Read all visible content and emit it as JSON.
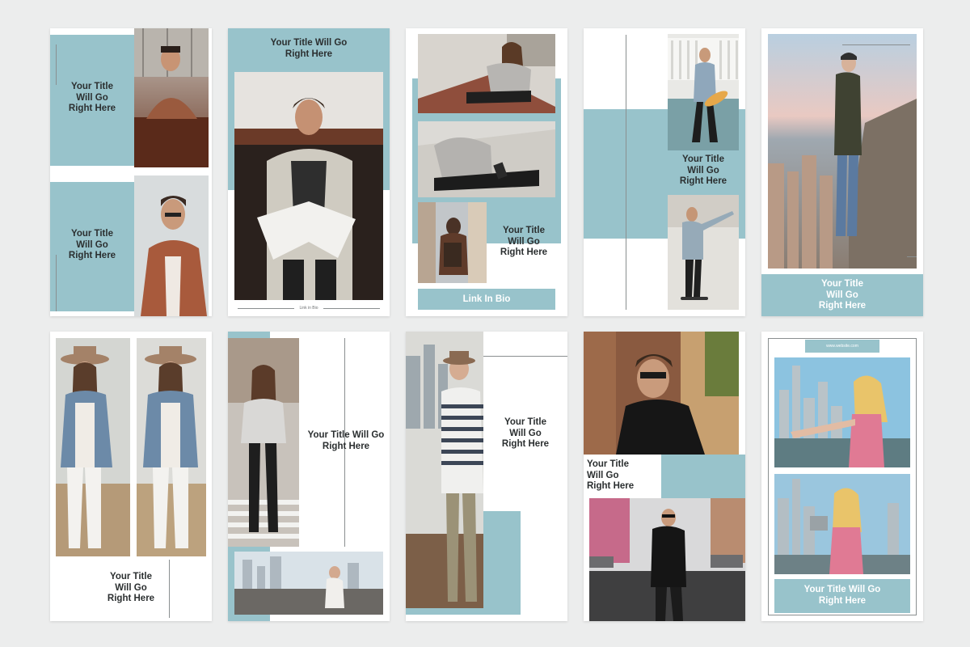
{
  "colors": {
    "accent": "#98c3cb",
    "background": "#eceded",
    "card": "#ffffff",
    "title_dark": "#2b2f30",
    "title_light": "#ffffff"
  },
  "templates": [
    {
      "titles": [
        "Your Title\nWill Go\nRight Here",
        "Your Title\nWill Go\nRight Here"
      ]
    },
    {
      "titles": [
        "Your Title Will Go\nRight Here"
      ],
      "footer": "Link in Bio"
    },
    {
      "titles": [
        "Your Title\nWill Go\nRight Here"
      ],
      "button": "Link In Bio"
    },
    {
      "titles": [
        "Your Title\nWill Go\nRight Here"
      ]
    },
    {
      "titles": [
        "Your Title\nWill Go\nRight Here"
      ]
    },
    {
      "titles": [
        "Your Title\nWill Go\nRight Here"
      ]
    },
    {
      "titles": [
        "Your Title Will Go\nRight Here"
      ]
    },
    {
      "titles": [
        "Your Title\nWill Go\nRight Here"
      ]
    },
    {
      "titles": [
        "Your Title\nWill Go\nRight Here"
      ]
    },
    {
      "titles": [
        "Your Title Will Go\nRight Here"
      ],
      "website": "www.website.com"
    }
  ]
}
